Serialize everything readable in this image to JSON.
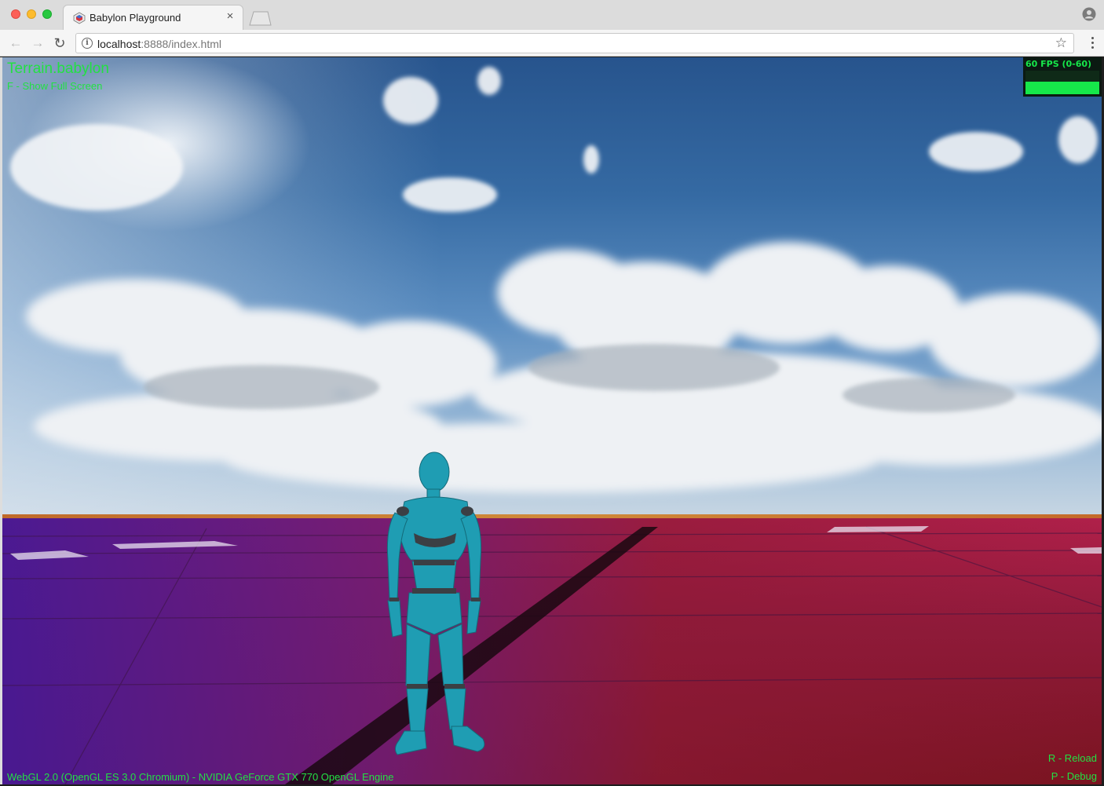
{
  "browser": {
    "tab_title": "Babylon Playground",
    "tab_close": "×",
    "url_host": "localhost",
    "url_rest": ":8888/index.html"
  },
  "icons": {
    "back": "arrow-left-icon",
    "forward": "arrow-right-icon",
    "reload": "reload-icon",
    "info": "info-icon",
    "bookmark": "star-icon",
    "menu": "kebab-menu-icon",
    "profile": "profile-icon"
  },
  "hud": {
    "title": "Terrain.babylon",
    "fullscreen_hint": "F - Show Full Screen",
    "renderer_info": "WebGL 2.0 (OpenGL ES 3.0 Chromium) - NVIDIA GeForce GTX 770 OpenGL Engine",
    "reload_hint": "R - Reload",
    "debug_hint": "P - Debug"
  },
  "fps_meter": {
    "label": "60 FPS (0-60)",
    "level": 0.55,
    "color": "#16e84a"
  },
  "scene_colors": {
    "character": "#1f9db3",
    "character_joint": "#3b3f44",
    "hud_text": "#23e043"
  }
}
